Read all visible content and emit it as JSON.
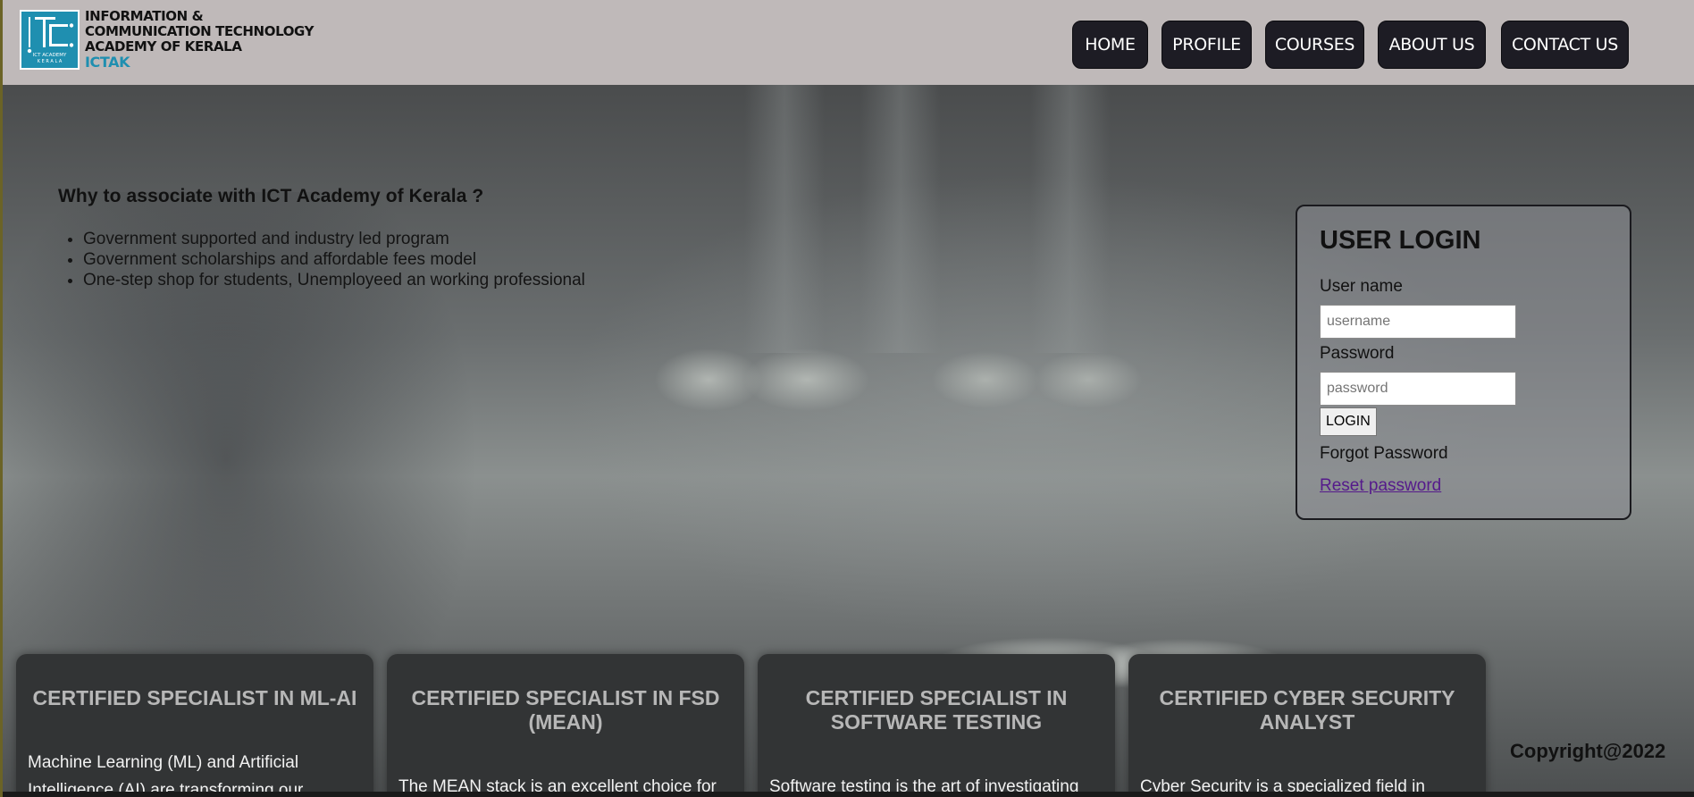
{
  "header": {
    "logo": {
      "line1": "INFORMATION &",
      "line2": "COMMUNICATION TECHNOLOGY",
      "line3": "ACADEMY OF KERALA",
      "short": "ICTAK",
      "badge_line1": "ICT ACADEMY",
      "badge_line2": "K E R A L A"
    },
    "nav": [
      "HOME",
      "PROFILE",
      "COURSES",
      "ABOUT US",
      "CONTACT US"
    ]
  },
  "hero": {
    "heading": "Why to associate with ICT Academy of Kerala ?",
    "points": [
      "Government supported and industry led program",
      "Government scholarships and affordable fees model",
      "One-step shop for students, Unemployeed an working professional"
    ]
  },
  "login": {
    "title": "USER LOGIN",
    "username_label": "User name",
    "username_placeholder": "username",
    "password_label": "Password",
    "password_placeholder": "password",
    "button": "LOGIN",
    "forgot_label": "Forgot Password",
    "reset_link": "Reset password"
  },
  "courses": [
    {
      "title": "CERTIFIED SPECIALIST IN ML-AI",
      "desc1": "Machine Learning (ML) and Artificial",
      "desc2": "Intelligence (AI) are transforming our"
    },
    {
      "title": "CERTIFIED SPECIALIST IN FSD (MEAN)",
      "desc1": "The MEAN stack is an excellent choice for",
      "desc2": ""
    },
    {
      "title": "CERTIFIED SPECIALIST IN SOFTWARE TESTING",
      "desc1": "Software testing is the art of investigating",
      "desc2": ""
    },
    {
      "title": "CERTIFIED CYBER SECURITY ANALYST",
      "desc1": "Cyber Security is a specialized field in",
      "desc2": ""
    }
  ],
  "footer": {
    "copyright": "Copyright@2022"
  },
  "colors": {
    "header_bg": "#bfb9b9",
    "nav_bg": "#1d1c24",
    "brand_blue": "#1f8fb0",
    "card_bg": "#323435",
    "link": "#551a8b"
  }
}
